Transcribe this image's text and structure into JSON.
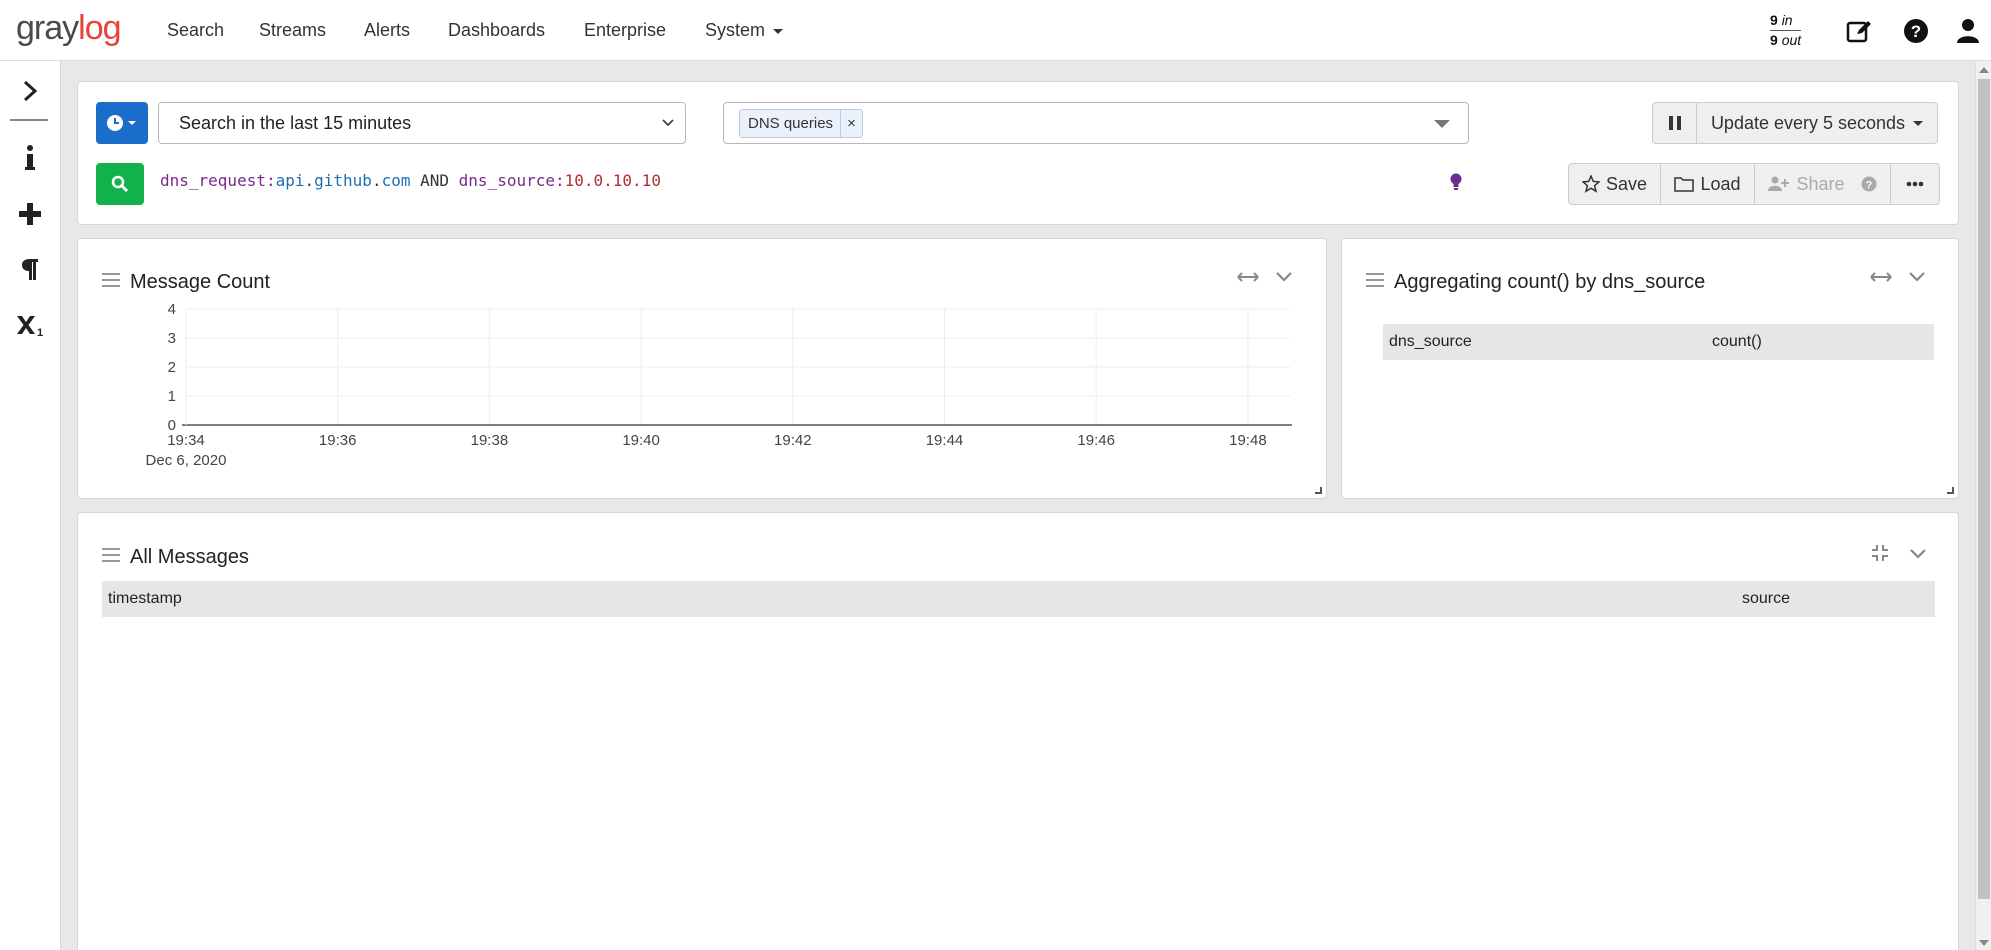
{
  "brand": {
    "part1": "gray",
    "part2": "log"
  },
  "nav": {
    "items": [
      "Search",
      "Streams",
      "Alerts",
      "Dashboards",
      "Enterprise",
      "System"
    ],
    "throughput_in_num": "9",
    "throughput_in_label": "in",
    "throughput_out_num": "9",
    "throughput_out_label": "out",
    "icons": [
      "edit-icon",
      "help-icon",
      "user-icon"
    ]
  },
  "sidebar": {
    "icons": [
      "expand-chevron-icon",
      "info-icon",
      "plus-icon",
      "paragraph-icon",
      "subscript-icon"
    ]
  },
  "search": {
    "time_range": "Search in the last 15 minutes",
    "stream_chip": "DNS queries",
    "stream_chip_remove": "×",
    "refresh_label": "Update every 5 seconds",
    "query": {
      "f1": "dns_request:",
      "v1a": "api",
      "v1b": ".",
      "v1c": "github",
      "v1d": ".",
      "v1e": "com",
      "op": " AND ",
      "f2": "dns_source:",
      "v2": "10.0.10.10"
    },
    "actions": {
      "save": "Save",
      "load": "Load",
      "share": "Share"
    }
  },
  "widgets": {
    "message_count": {
      "title": "Message Count"
    },
    "aggregation": {
      "title": "Aggregating count() by dns_source",
      "columns": [
        "dns_source",
        "count()"
      ]
    },
    "all_messages": {
      "title": "All Messages",
      "columns": [
        "timestamp",
        "source"
      ]
    }
  },
  "chart_data": {
    "type": "line",
    "title": "Message Count",
    "x": [
      "19:34",
      "19:36",
      "19:38",
      "19:40",
      "19:42",
      "19:44",
      "19:46",
      "19:48"
    ],
    "x_sublabel": "Dec 6, 2020",
    "yticks": [
      0,
      1,
      2,
      3,
      4
    ],
    "ylim": [
      0,
      4
    ],
    "series": [],
    "grid": true,
    "colors": {
      "grid": "#ececec",
      "axis": "#555555"
    }
  },
  "colors": {
    "primary": "#1a6dc9",
    "success": "#11b14c",
    "brand_red": "#e5443b"
  }
}
